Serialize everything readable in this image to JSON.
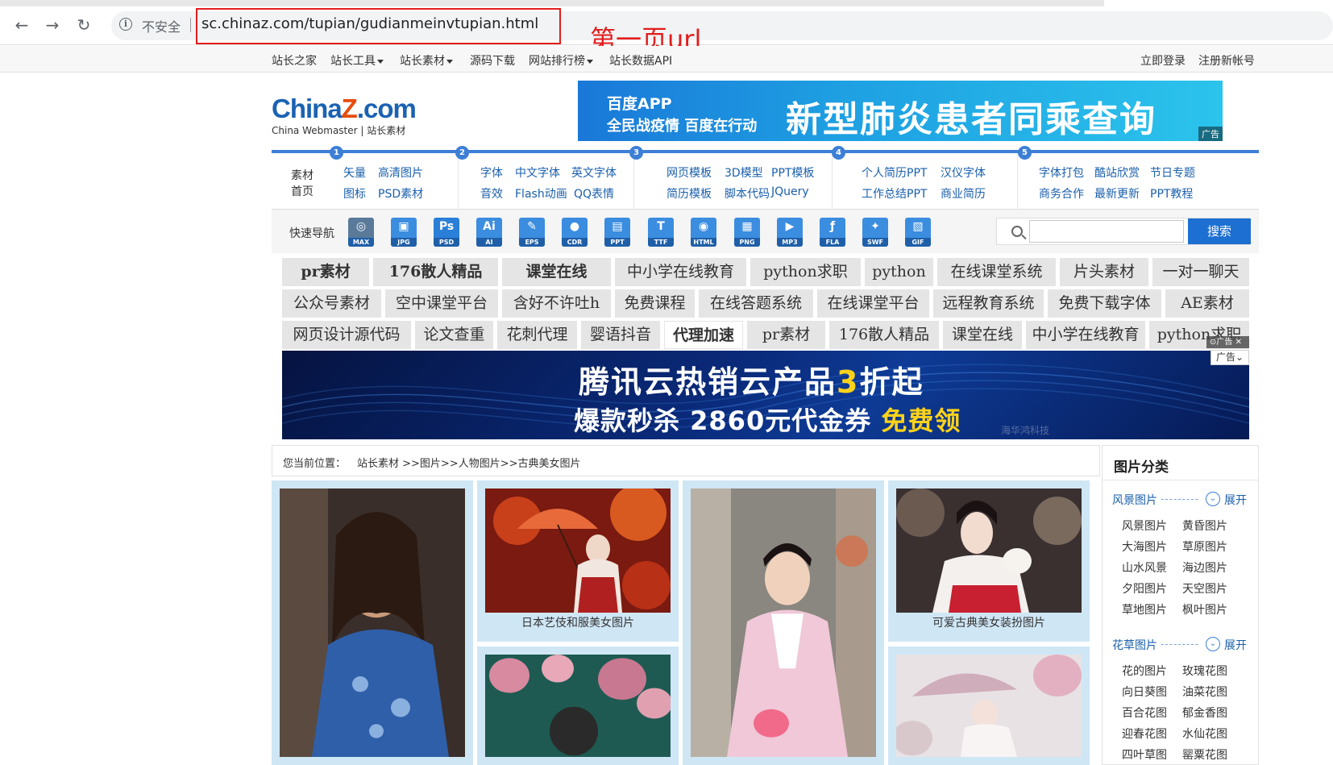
{
  "browser": {
    "insecure_label": "不安全",
    "url": "sc.chinaz.com/tupian/gudianmeinvtupian.html",
    "annotation": "第一页url"
  },
  "topbar": {
    "left_items": [
      {
        "label": "站长之家",
        "dropdown": false
      },
      {
        "label": "站长工具",
        "dropdown": true
      },
      {
        "label": "站长素材",
        "dropdown": true
      },
      {
        "label": "源码下载",
        "dropdown": false
      },
      {
        "label": "网站排行榜",
        "dropdown": true
      },
      {
        "label": "站长数据API",
        "dropdown": false
      }
    ],
    "login": "立即登录",
    "register": "注册新帐号"
  },
  "logo": {
    "part1": "China",
    "z": "Z",
    "part2": ".com",
    "sub_en": "China Webmaster",
    "sub_zh": "站长素材"
  },
  "ad_top": {
    "brand": "百度APP",
    "slogan": "全民战疫情 百度在行动",
    "headline": "新型肺炎患者同乘查询",
    "tag": "广告"
  },
  "catnav": {
    "home_line1": "素材",
    "home_line2": "首页",
    "groups": [
      {
        "badge": "1",
        "links": [
          "矢量",
          "高清图片",
          "图标",
          "PSD素材"
        ]
      },
      {
        "badge": "2",
        "links": [
          "字体",
          "中文字体",
          "英文字体",
          "音效",
          "Flash动画",
          "QQ表情"
        ]
      },
      {
        "badge": "3",
        "links": [
          "网页模板",
          "3D模型",
          "PPT模板",
          "简历模板",
          "脚本代码",
          "JQuery"
        ]
      },
      {
        "badge": "4",
        "links": [
          "个人简历PPT",
          "汉仪字体",
          "工作总结PPT",
          "商业简历"
        ]
      },
      {
        "badge": "5",
        "links": [
          "字体打包",
          "酷站欣赏",
          "节日专题",
          "商务合作",
          "最新更新",
          "PPT教程"
        ]
      }
    ]
  },
  "quicknav": {
    "label": "快速导航",
    "icons": [
      {
        "glyph": "◎",
        "text": "MAX",
        "color": "#5a7a9a"
      },
      {
        "glyph": "▣",
        "text": "JPG",
        "color": "#3b8de0"
      },
      {
        "glyph": "Ps",
        "text": "PSD",
        "color": "#2a7fd8"
      },
      {
        "glyph": "Ai",
        "text": "AI",
        "color": "#3b8de0"
      },
      {
        "glyph": "✎",
        "text": "EPS",
        "color": "#3b8de0"
      },
      {
        "glyph": "●",
        "text": "CDR",
        "color": "#3b8de0"
      },
      {
        "glyph": "▤",
        "text": "PPT",
        "color": "#3b8de0"
      },
      {
        "glyph": "T",
        "text": "TTF",
        "color": "#3b8de0"
      },
      {
        "glyph": "◉",
        "text": "HTML",
        "color": "#3b8de0"
      },
      {
        "glyph": "▦",
        "text": "PNG",
        "color": "#3b8de0"
      },
      {
        "glyph": "▶",
        "text": "MP3",
        "color": "#3b8de0"
      },
      {
        "glyph": "ƒ",
        "text": "FLA",
        "color": "#3b8de0"
      },
      {
        "glyph": "✦",
        "text": "SWF",
        "color": "#3b8de0"
      },
      {
        "glyph": "▧",
        "text": "GIF",
        "color": "#3b8de0"
      }
    ],
    "search_button": "搜索",
    "search_placeholder": ""
  },
  "keywords": {
    "row1": [
      "pr素材",
      "176散人精品",
      "课堂在线",
      "中小学在线教育",
      "python求职",
      "python",
      "在线课堂系统",
      "片头素材",
      "一对一聊天"
    ],
    "row2": [
      "公众号素材",
      "空中课堂平台",
      "含好不许吐h",
      "免费课程",
      "在线答题系统",
      "在线课堂平台",
      "远程教育系统",
      "免费下载字体",
      "AE素材"
    ],
    "row3": [
      "网页设计源代码",
      "论文查重",
      "花刺代理",
      "婴语抖音",
      "代理加速",
      "pr素材",
      "176散人精品",
      "课堂在线",
      "中小学在线教育",
      "python求职"
    ]
  },
  "ad_banner": {
    "line1_a": "腾讯云热销云产品",
    "line1_b": "3",
    "line1_c": "折起",
    "line2_a": "爆款秒杀 2860元代金券 ",
    "line2_b": "免费领",
    "faint": "海华鸿科技",
    "ctl_label": "广告",
    "tag": "广告"
  },
  "breadcrumb": {
    "prefix": "您当前位置：",
    "path": "站长素材 >>图片>>人物图片>>古典美女图片"
  },
  "images": [
    {
      "caption": ""
    },
    {
      "caption": "日本艺伎和服美女图片"
    },
    {
      "caption": ""
    },
    {
      "caption": "可爱古典美女装扮图片"
    },
    {
      "caption": ""
    },
    {
      "caption": ""
    }
  ],
  "sidebar": {
    "title": "图片分类",
    "expand_label": "展开",
    "sections": [
      {
        "name": "风景图片",
        "items": [
          "风景图片",
          "黄昏图片",
          "大海图片",
          "草原图片",
          "山水风景",
          "海边图片",
          "夕阳图片",
          "天空图片",
          "草地图片",
          "枫叶图片"
        ]
      },
      {
        "name": "花草图片",
        "items": [
          "花的图片",
          "玫瑰花图",
          "向日葵图",
          "油菜花图",
          "百合花图",
          "郁金香图",
          "迎春花图",
          "水仙花图",
          "四叶草图",
          "罂粟花图"
        ]
      }
    ]
  },
  "colors": {
    "accent": "#3d7fd6",
    "link": "#1a5fab",
    "annotation": "#e31d1d",
    "card_bg": "#cfe6f5"
  }
}
